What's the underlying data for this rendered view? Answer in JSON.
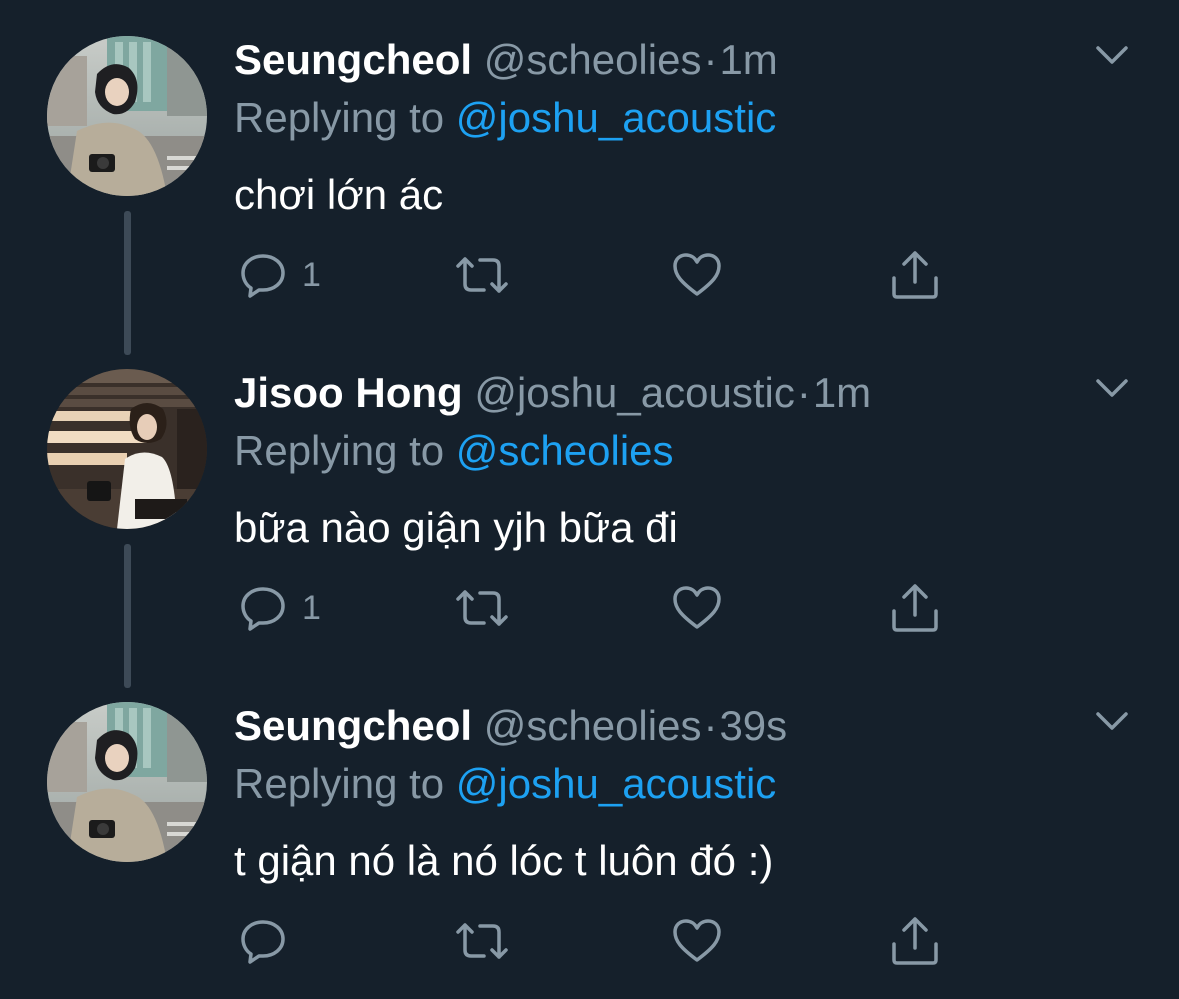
{
  "tweets": [
    {
      "name": "Seungcheol",
      "handle": "@scheolies",
      "separator": "·",
      "time": "1m",
      "replying_prefix": "Replying to",
      "replying_to": "@joshu_acoustic",
      "text": "chơi lớn ác",
      "reply_count": "1",
      "avatar": "seungcheol-avatar"
    },
    {
      "name": "Jisoo Hong",
      "handle": "@joshu_acoustic",
      "separator": "·",
      "time": "1m",
      "replying_prefix": "Replying to",
      "replying_to": "@scheolies",
      "text": "bữa nào giận yjh bữa đi",
      "reply_count": "1",
      "avatar": "jisoo-avatar"
    },
    {
      "name": "Seungcheol",
      "handle": "@scheolies",
      "separator": "·",
      "time": "39s",
      "replying_prefix": "Replying to",
      "replying_to": "@joshu_acoustic",
      "text": "t giận nó là nó lóc t luôn đó :)",
      "reply_count": "",
      "avatar": "seungcheol-avatar"
    }
  ],
  "icons": {
    "reply": "reply-icon",
    "retweet": "retweet-icon",
    "like": "heart-icon",
    "share": "share-icon",
    "menu": "chevron-down-icon"
  },
  "colors": {
    "background": "#15202b",
    "secondary_text": "#8899a6",
    "link": "#1da1f2",
    "thread_line": "#3d4a57"
  }
}
